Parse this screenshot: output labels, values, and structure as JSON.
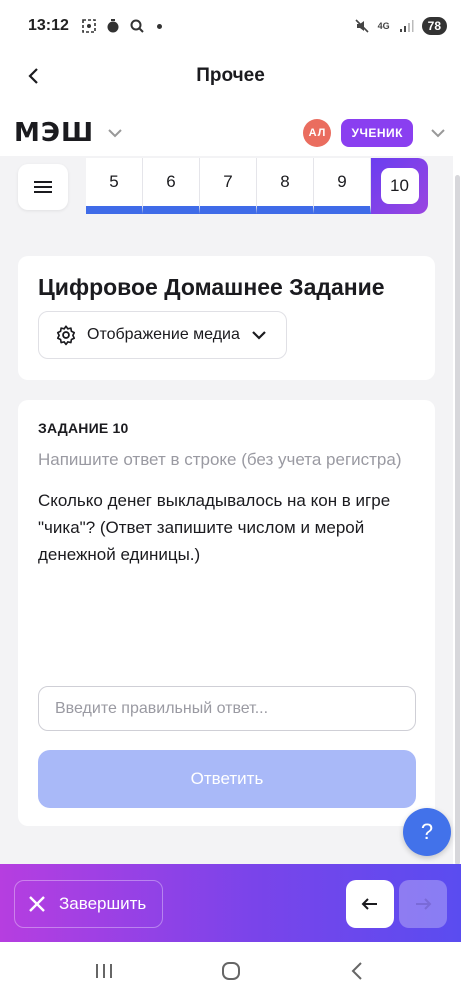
{
  "status_bar": {
    "time": "13:12",
    "left_icons": [
      "screenshot-icon",
      "timer-icon",
      "search-icon",
      "dot"
    ],
    "right_icons": [
      "mute-icon",
      "4g-icon",
      "signal-icon"
    ],
    "network": "4G",
    "battery": "78"
  },
  "header": {
    "title": "Прочее"
  },
  "brand": {
    "logo": "МЭШ",
    "avatar_initials": "АЛ",
    "role": "УЧЕНИК"
  },
  "task_nav": {
    "numbers": [
      "5",
      "6",
      "7",
      "8",
      "9",
      "10"
    ],
    "active": "10"
  },
  "assignment": {
    "title": "Цифровое Домашнее Задание",
    "media_button": "Отображение медиа"
  },
  "task": {
    "label": "ЗАДАНИЕ 10",
    "hint": "Напишите ответ в строке (без учета регистра)",
    "question": "Сколько денег выкладывалось на кон в игре \"чика\"? (Ответ запишите числом и мерой денежной единицы.)",
    "input_placeholder": "Введите правильный ответ...",
    "submit_label": "Ответить"
  },
  "help": {
    "label": "?"
  },
  "bottom": {
    "finish_label": "Завершить"
  },
  "colors": {
    "accent_blue": "#3f6be8",
    "accent_purple": "#8a3ff0",
    "submit_disabled": "#a9b9f8",
    "avatar": "#ea6d5f"
  }
}
